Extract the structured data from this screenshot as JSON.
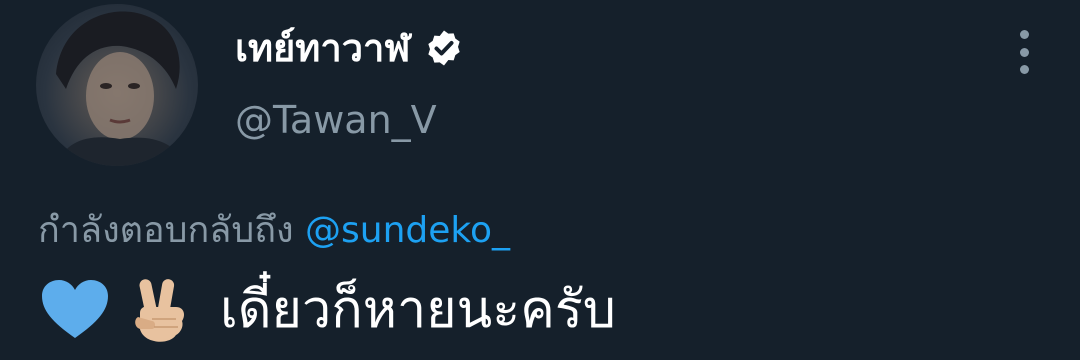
{
  "tweet": {
    "display_name": "เทย์ทาวาฬ",
    "verified_icon": "verified-badge-icon",
    "handle": "@Tawan_V",
    "more_icon": "more-vertical-icon",
    "reply_prefix": "กำลังตอบกลับถึง ",
    "reply_mention": "@sundeko_",
    "body_emojis": [
      "blue-heart-icon",
      "victory-hand-icon"
    ],
    "body_text": "เดี๋ยวก็หายนะครับ",
    "colors": {
      "background": "#15202b",
      "secondary_text": "#8899a6",
      "link": "#1da1f2",
      "heart": "#5dadec",
      "skin_tone": "#e8c29f"
    }
  }
}
